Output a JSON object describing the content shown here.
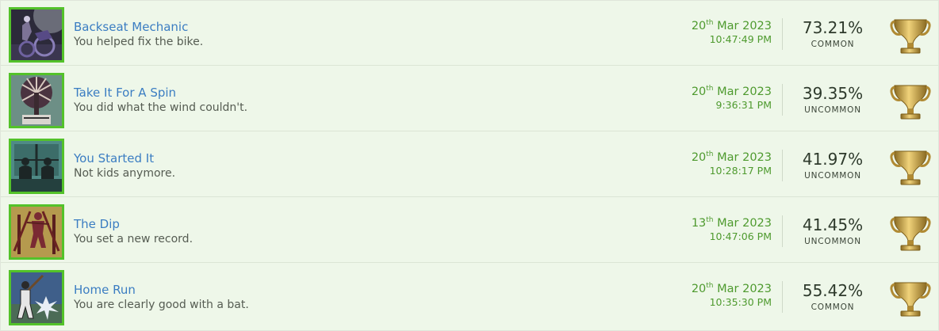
{
  "achievements": [
    {
      "title": "Backseat Mechanic",
      "description": "You helped fix the bike.",
      "date_day": "20",
      "date_suffix": "th",
      "date_rest": " Mar 2023",
      "time": "10:47:49 PM",
      "percent": "73.21%",
      "rarity": "COMMON",
      "icon": "mechanic-bike-icon"
    },
    {
      "title": "Take It For A Spin",
      "description": "You did what the wind couldn't.",
      "date_day": "20",
      "date_suffix": "th",
      "date_rest": " Mar 2023",
      "time": "9:36:31 PM",
      "percent": "39.35%",
      "rarity": "UNCOMMON",
      "icon": "windmill-icon"
    },
    {
      "title": "You Started It",
      "description": "Not kids anymore.",
      "date_day": "20",
      "date_suffix": "th",
      "date_rest": " Mar 2023",
      "time": "10:28:17 PM",
      "percent": "41.97%",
      "rarity": "UNCOMMON",
      "icon": "seated-figures-icon"
    },
    {
      "title": "The Dip",
      "description": "You set a new record.",
      "date_day": "13",
      "date_suffix": "th",
      "date_rest": " Mar 2023",
      "time": "10:47:06 PM",
      "percent": "41.45%",
      "rarity": "UNCOMMON",
      "icon": "bars-dip-icon"
    },
    {
      "title": "Home Run",
      "description": "You are clearly good with a bat.",
      "date_day": "20",
      "date_suffix": "th",
      "date_rest": " Mar 2023",
      "time": "10:35:30 PM",
      "percent": "55.42%",
      "rarity": "COMMON",
      "icon": "baseball-batter-icon"
    }
  ],
  "colors": {
    "title_link": "#3b7dc2",
    "date_green": "#4e9a2e",
    "thumb_border": "#53c22a",
    "trophy_gold": "#c9a043"
  }
}
